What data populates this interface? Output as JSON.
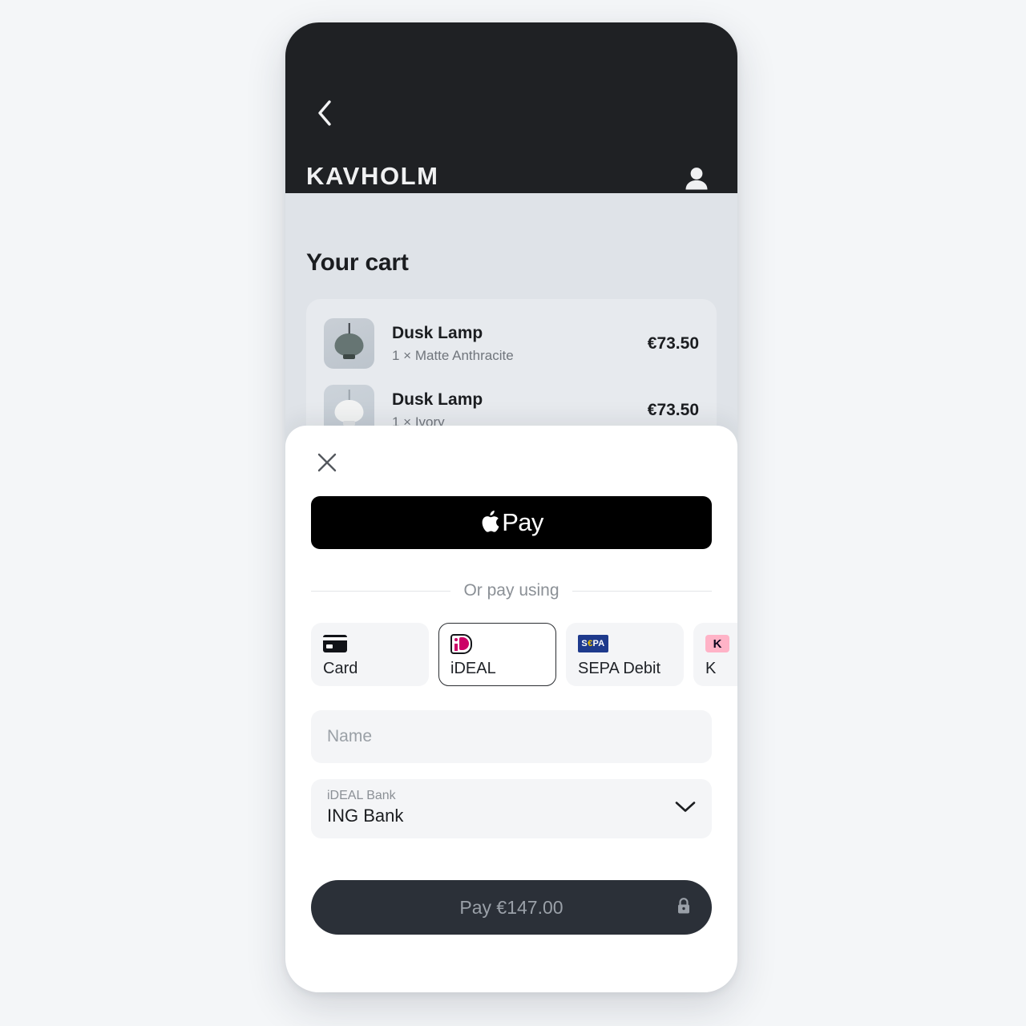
{
  "app": {
    "brand": "KAVHOLM",
    "back_icon": "chevron-left-icon",
    "account_icon": "person-icon"
  },
  "cart": {
    "title": "Your cart",
    "items": [
      {
        "name": "Dusk Lamp",
        "variant": "1 × Matte Anthracite",
        "price": "€73.50",
        "thumb": "pendant-lamp-anthracite"
      },
      {
        "name": "Dusk Lamp",
        "variant": "1 × Ivory",
        "price": "€73.50",
        "thumb": "pendant-lamp-ivory"
      }
    ]
  },
  "sheet": {
    "close_icon": "close-icon",
    "apple_pay": {
      "icon": "apple-logo-icon",
      "label": "Pay"
    },
    "divider_text": "Or pay using",
    "methods": [
      {
        "id": "card",
        "label": "Card",
        "icon": "credit-card-icon",
        "selected": false
      },
      {
        "id": "ideal",
        "label": "iDEAL",
        "icon": "ideal-logo-icon",
        "selected": true
      },
      {
        "id": "sepa_debit",
        "label": "SEPA Debit",
        "icon": "sepa-logo-icon",
        "selected": false
      },
      {
        "id": "klarna",
        "label": "K",
        "icon": "klarna-logo-icon",
        "selected": false
      }
    ],
    "name_field": {
      "value": "",
      "placeholder": "Name"
    },
    "bank_select": {
      "label": "iDEAL Bank",
      "value": "ING Bank",
      "chevron_icon": "chevron-down-icon"
    },
    "pay_button": {
      "label": "Pay €147.00",
      "lock_icon": "lock-icon"
    }
  },
  "colors": {
    "page_bg": "#f4f6f8",
    "header_bg": "#1f2124",
    "cart_bg": "#dfe3e8",
    "sheet_bg": "#ffffff",
    "pay_button_bg": "#2b3038",
    "accent_ideal": "#cc0066",
    "accent_sepa": "#1e3a8c",
    "accent_klarna": "#ffb3c7"
  }
}
